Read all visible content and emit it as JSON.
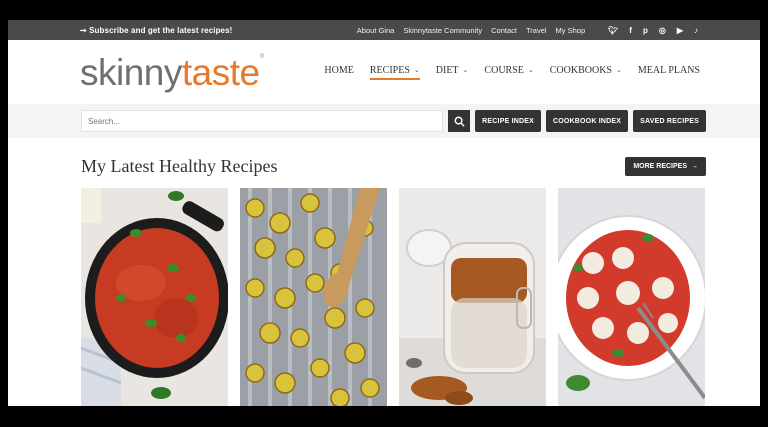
{
  "topbar": {
    "promo": "➞ Subscribe and get the latest recipes!",
    "links": [
      "About Gina",
      "Skinnytaste Community",
      "Contact",
      "Travel",
      "My Shop"
    ],
    "socials": [
      "twitter-icon",
      "facebook-icon",
      "pinterest-icon",
      "instagram-icon",
      "youtube-icon",
      "tiktok-icon"
    ]
  },
  "logo": {
    "part1": "skinny",
    "part2": "taste",
    "mark": "®"
  },
  "nav": [
    {
      "label": "HOME",
      "dropdown": false
    },
    {
      "label": "RECIPES",
      "dropdown": true
    },
    {
      "label": "DIET",
      "dropdown": true
    },
    {
      "label": "COURSE",
      "dropdown": true
    },
    {
      "label": "COOKBOOKS",
      "dropdown": true
    },
    {
      "label": "MEAL PLANS",
      "dropdown": false
    }
  ],
  "search": {
    "placeholder": "Search...",
    "buttons": [
      "RECIPE INDEX",
      "COOKBOOK INDEX",
      "SAVED RECIPES"
    ]
  },
  "latest": {
    "title": "My Latest Healthy Recipes",
    "more": "MORE RECIPES"
  },
  "colors": {
    "accent": "#e8792a",
    "dark": "#333333"
  }
}
